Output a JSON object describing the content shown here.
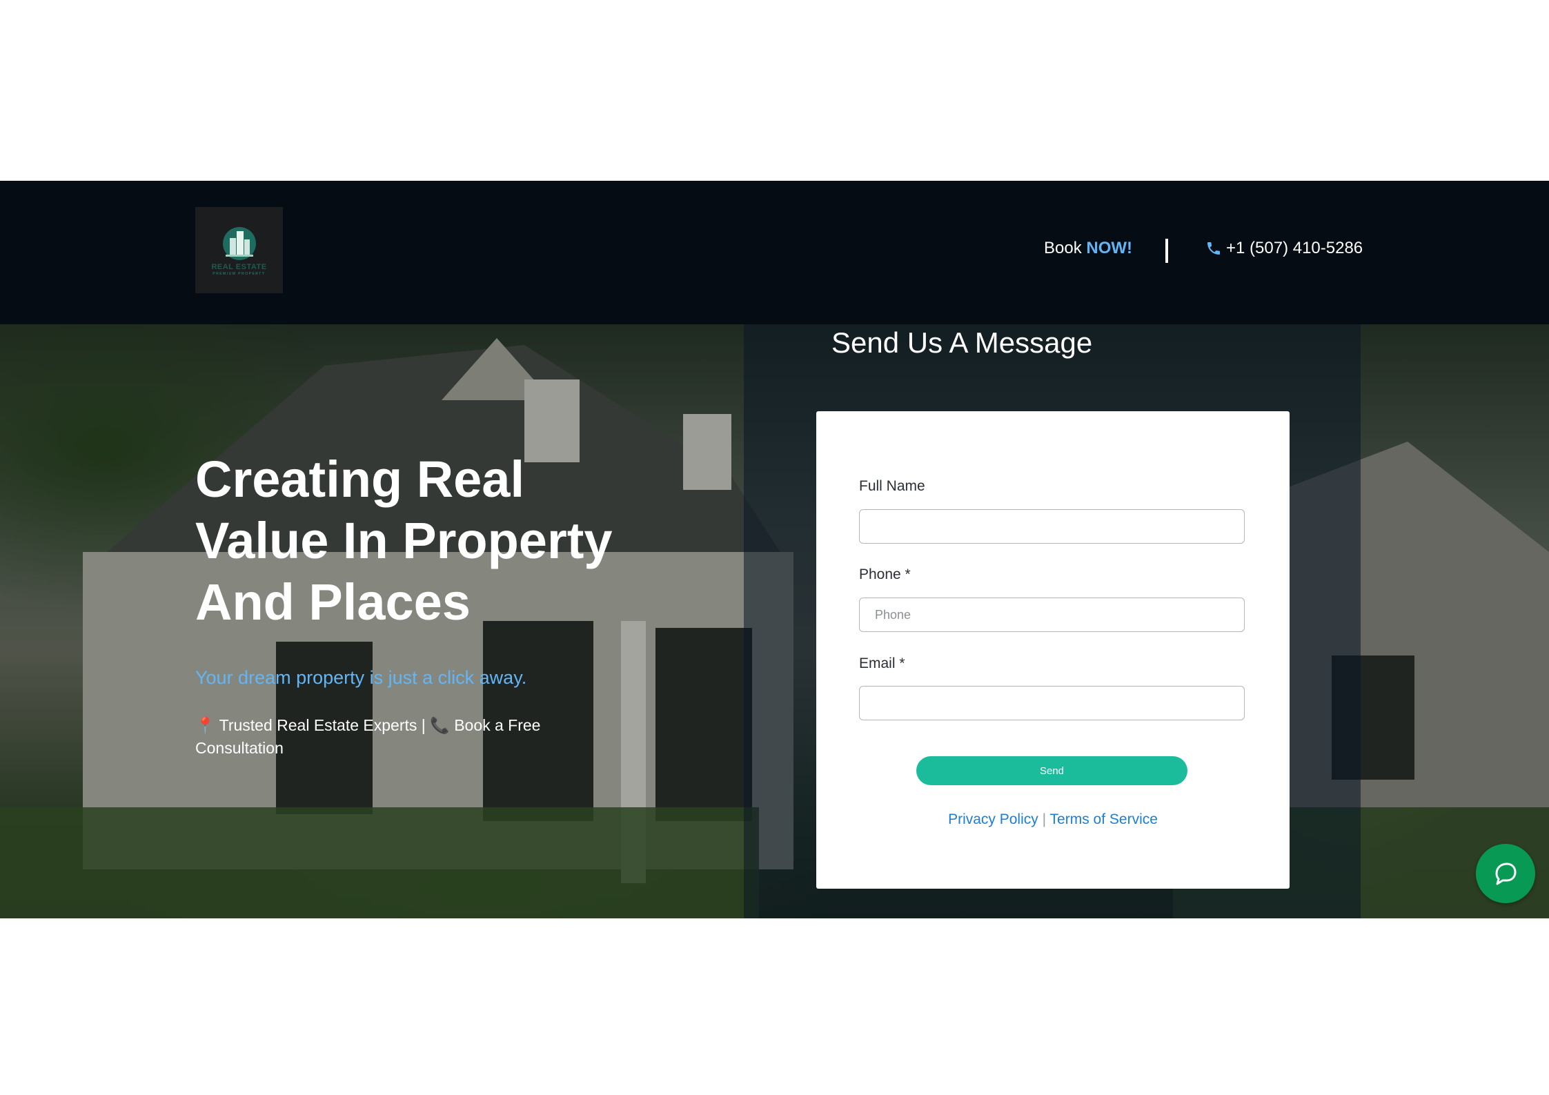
{
  "header": {
    "logo_text": "REAL ESTATE",
    "logo_subtext": "PREMIUM PROPERTY",
    "book_label": "Book",
    "book_emphasis": "NOW!",
    "phone": "+1 (507) 410-5286"
  },
  "hero": {
    "title": "Creating Real Value In Property And Places",
    "subtitle": "Your dream property is just a click away.",
    "tagline_part1": "Trusted Real Estate Experts |",
    "tagline_part2": "Book a Free Consultation"
  },
  "form": {
    "heading": "Send Us A Message",
    "full_name_label": "Full Name",
    "full_name_value": "",
    "phone_label": "Phone *",
    "phone_placeholder": "Phone",
    "email_label": "Email *",
    "email_value": "",
    "send_label": "Send",
    "privacy_label": "Privacy Policy",
    "separator": "|",
    "terms_label": "Terms of Service"
  },
  "colors": {
    "header_bg": "#050c13",
    "accent_blue": "#62b6f5",
    "send_button": "#1abc9c",
    "chat_button": "#089a54",
    "link": "#1a7fd6"
  },
  "icons": {
    "phone": "phone-icon",
    "pin": "pin-icon",
    "consult_phone": "phone-receiver-icon",
    "chat": "chat-bubble-icon"
  }
}
